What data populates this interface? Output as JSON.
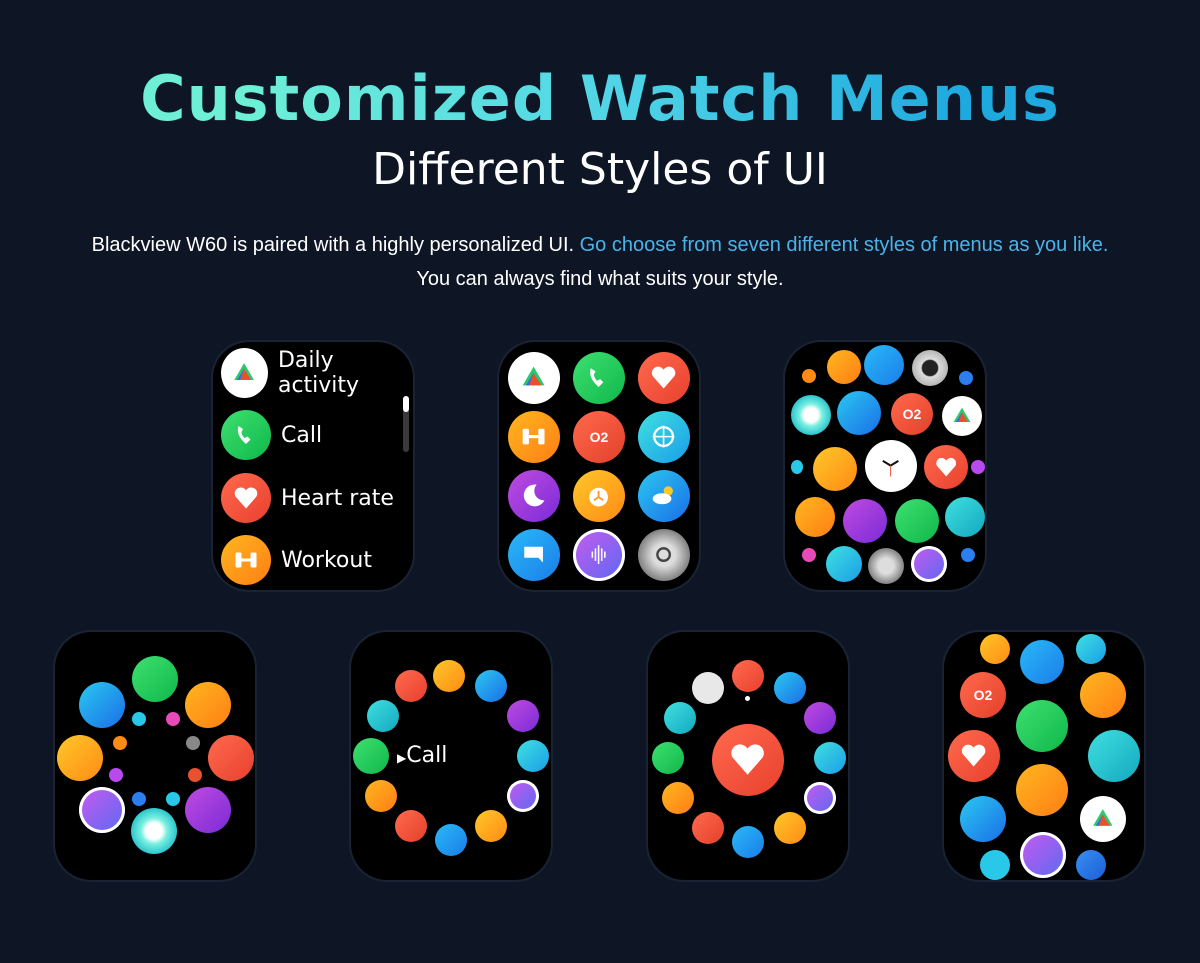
{
  "header": {
    "title": "Customized Watch Menus",
    "subtitle": "Different Styles of UI",
    "description_plain": "Blackview W60 is paired with a highly personalized UI. ",
    "description_highlight": "Go choose from seven different styles of menus as you like.",
    "description_line2": "You can always find what suits your style."
  },
  "colors": {
    "background": "#0e1626",
    "title_gradient_start": "#6ef0d6",
    "title_gradient_end": "#1eaadf",
    "highlight": "#4cb3e8"
  },
  "watch_list": {
    "items": [
      {
        "label": "Daily activity",
        "icon": "daily-activity-icon"
      },
      {
        "label": "Call",
        "icon": "call-icon"
      },
      {
        "label": "Heart rate",
        "icon": "heart-rate-icon"
      },
      {
        "label": "Workout",
        "icon": "workout-icon"
      }
    ]
  },
  "watch_grid": {
    "icons": [
      "daily-activity-icon",
      "call-icon",
      "heart-rate-icon",
      "workout-icon",
      "blood-oxygen-icon",
      "compass-icon",
      "sleep-icon",
      "alarm-icon",
      "weather-icon",
      "message-icon",
      "voice-assistant-icon",
      "settings-icon"
    ]
  },
  "watch_honeycomb": {
    "center_icon": "clock-face-icon"
  },
  "watch_ring_call": {
    "center_label": "Call"
  },
  "glyphs": {
    "o2": "O2",
    "call_arrow": "▶"
  }
}
